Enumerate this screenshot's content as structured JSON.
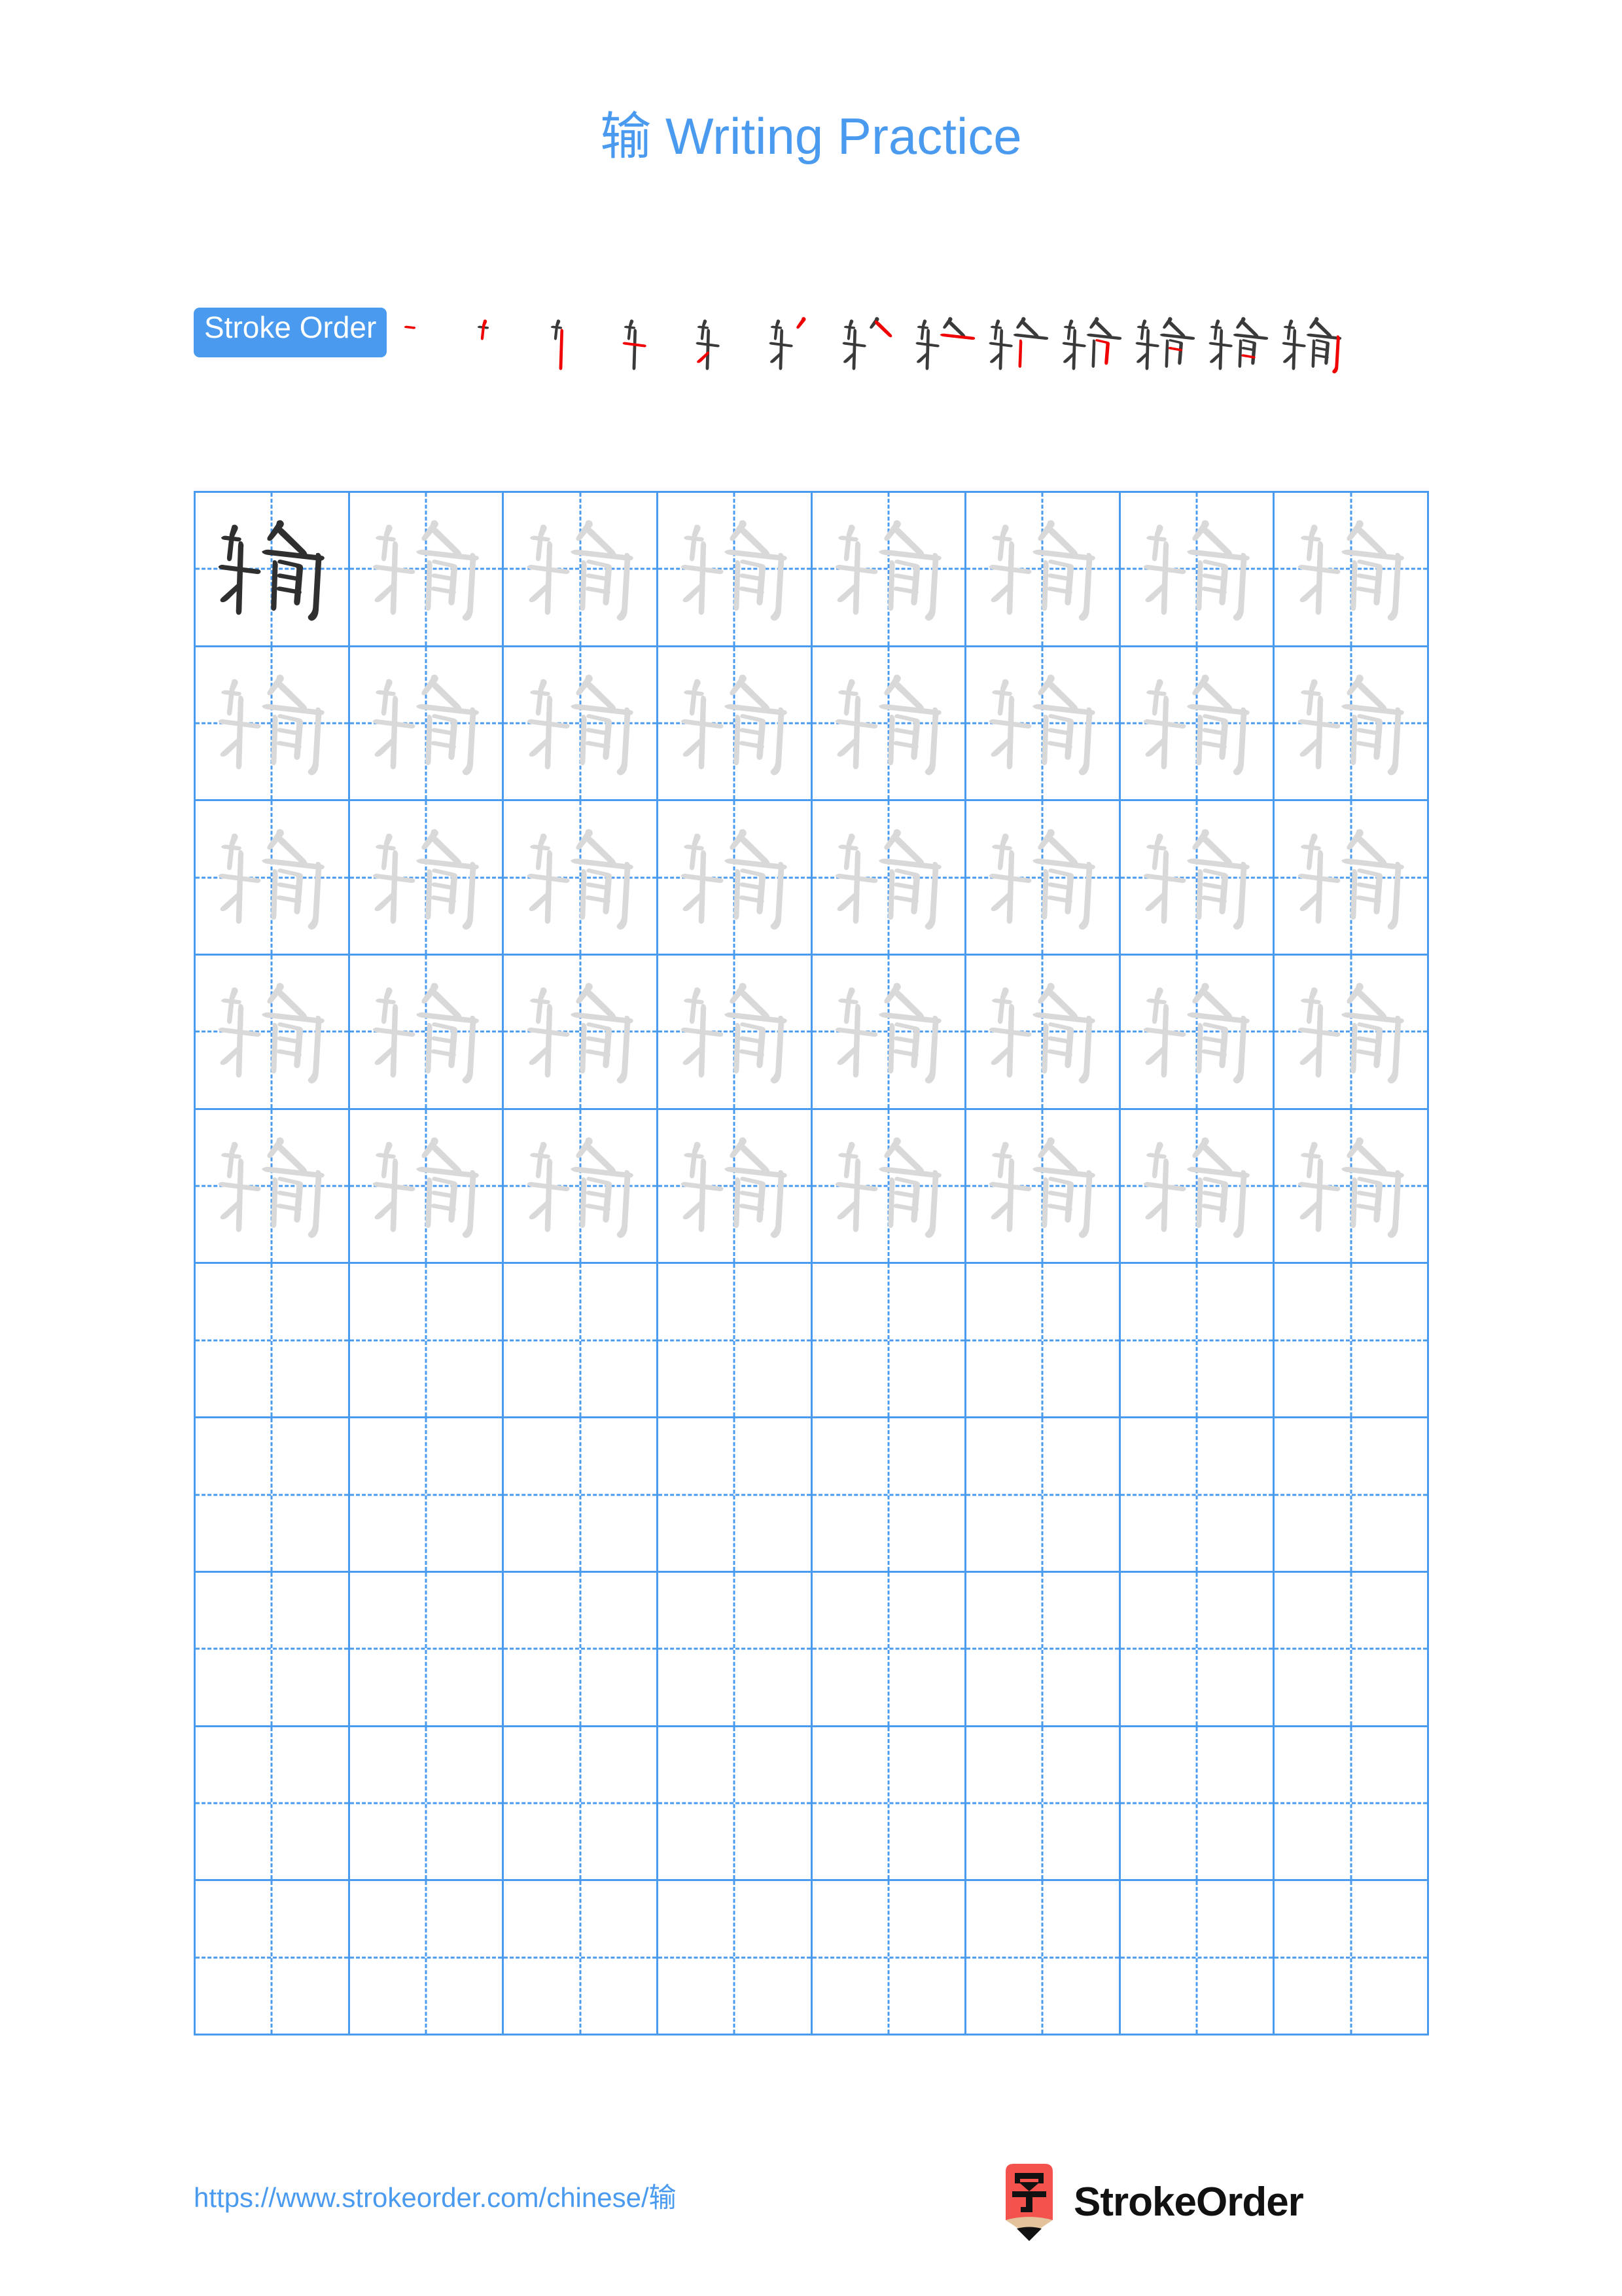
{
  "page": {
    "character": "输",
    "title": "输 Writing Practice",
    "title_suffix": "Writing Practice",
    "background_color": "#ffffff",
    "accent_color": "#4a9bf0",
    "highlight_stroke_color": "#f00000",
    "completed_stroke_color": "#3a3a3a",
    "trace_glyph_color": "#d9d9d9",
    "model_glyph_color": "#2f2f2f"
  },
  "stroke_order": {
    "badge_label": "Stroke Order",
    "total_strokes": 13,
    "steps": [
      {
        "index": 1,
        "strokes_shown": 1
      },
      {
        "index": 2,
        "strokes_shown": 2
      },
      {
        "index": 3,
        "strokes_shown": 3
      },
      {
        "index": 4,
        "strokes_shown": 4
      },
      {
        "index": 5,
        "strokes_shown": 5
      },
      {
        "index": 6,
        "strokes_shown": 6
      },
      {
        "index": 7,
        "strokes_shown": 7
      },
      {
        "index": 8,
        "strokes_shown": 8
      },
      {
        "index": 9,
        "strokes_shown": 9
      },
      {
        "index": 10,
        "strokes_shown": 10
      },
      {
        "index": 11,
        "strokes_shown": 11
      },
      {
        "index": 12,
        "strokes_shown": 12
      },
      {
        "index": 13,
        "strokes_shown": 13
      }
    ]
  },
  "practice_grid": {
    "rows": 10,
    "columns": 8,
    "filled_rows": 5,
    "model_cell": {
      "row": 1,
      "column": 1
    },
    "cell_guides": [
      "vertical-dashed-center",
      "horizontal-dashed-center"
    ]
  },
  "footer": {
    "url": "https://www.strokeorder.com/chinese/输",
    "brand_name": "StrokeOrder",
    "logo_character": "字",
    "logo_body_color": "#f4524d",
    "logo_wood_color": "#e4c39c",
    "logo_tip_color": "#111111"
  }
}
